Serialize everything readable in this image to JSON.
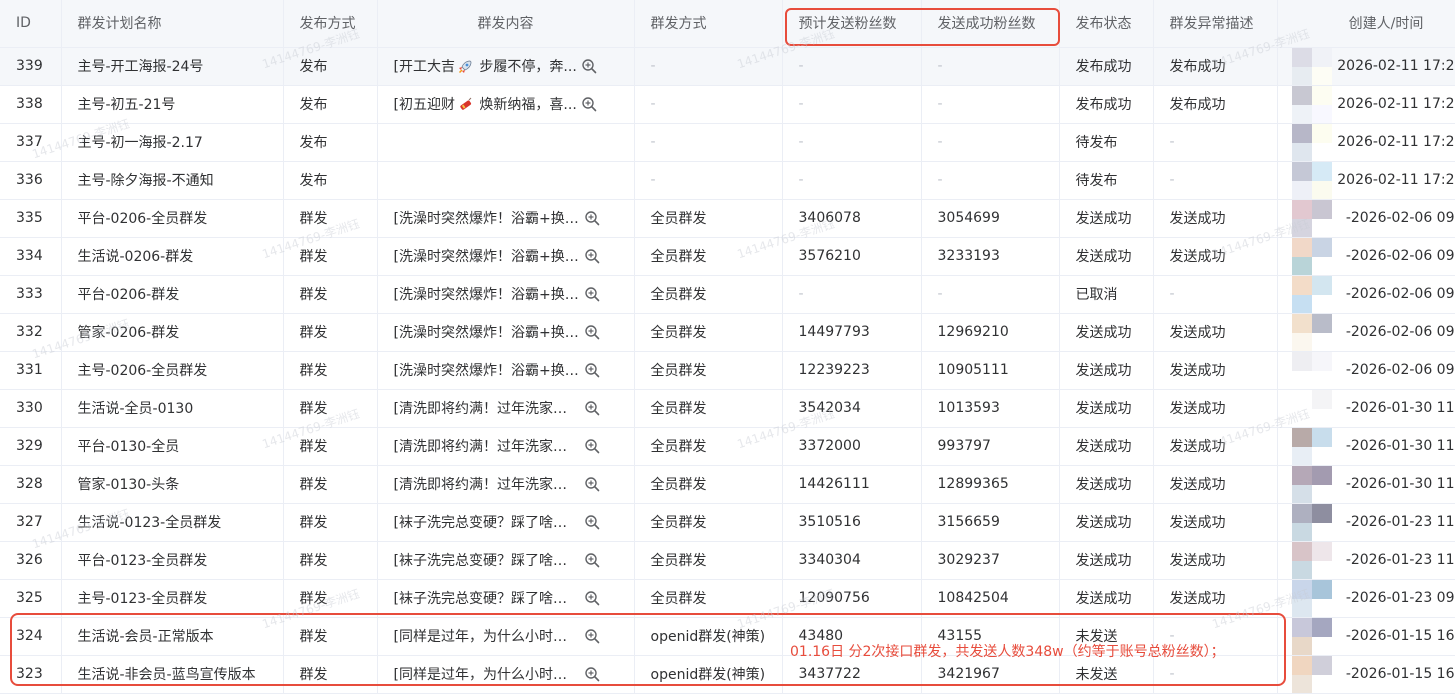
{
  "table": {
    "headers": {
      "id": "ID",
      "plan_name": "群发计划名称",
      "publish_method": "发布方式",
      "content": "群发内容",
      "mass_method": "群发方式",
      "expected_fans": "预计发送粉丝数",
      "success_fans": "发送成功粉丝数",
      "publish_status": "发布状态",
      "anomaly": "群发异常描述",
      "creator_time": "创建人/时间"
    },
    "rows": [
      {
        "id": "339",
        "name": "主号-开工海报-24号",
        "method": "发布",
        "content_pre": "[开工大吉",
        "emoji": "rocket",
        "content_post": " 步履不停，奔...",
        "mass": "-",
        "expected": "-",
        "success": "-",
        "status": "发布成功",
        "anomaly": "发布成功",
        "time": "2026-02-11 17:2"
      },
      {
        "id": "338",
        "name": "主号-初五-21号",
        "method": "发布",
        "content_pre": "[初五迎财",
        "emoji": "firecracker",
        "content_post": " 焕新纳福，喜...",
        "mass": "-",
        "expected": "-",
        "success": "-",
        "status": "发布成功",
        "anomaly": "发布成功",
        "time": "2026-02-11 17:2"
      },
      {
        "id": "337",
        "name": "主号-初一海报-2.17",
        "method": "发布",
        "content_pre": "",
        "emoji": "",
        "content_post": "",
        "mass": "-",
        "expected": "-",
        "success": "-",
        "status": "待发布",
        "anomaly": "-",
        "time": "2026-02-11 17:2"
      },
      {
        "id": "336",
        "name": "主号-除夕海报-不通知",
        "method": "发布",
        "content_pre": "",
        "emoji": "",
        "content_post": "",
        "mass": "-",
        "expected": "-",
        "success": "-",
        "status": "待发布",
        "anomaly": "-",
        "time": "2026-02-11 17:2"
      },
      {
        "id": "335",
        "name": "平台-0206-全员群发",
        "method": "群发",
        "content_pre": "[洗澡时突然爆炸！浴霸+换气...",
        "emoji": "",
        "content_post": "",
        "mass": "全员群发",
        "expected": "3406078",
        "success": "3054699",
        "status": "发送成功",
        "anomaly": "发送成功",
        "time": "-2026-02-06 09"
      },
      {
        "id": "334",
        "name": "生活说-0206-群发",
        "method": "群发",
        "content_pre": "[洗澡时突然爆炸！浴霸+换气...",
        "emoji": "",
        "content_post": "",
        "mass": "全员群发",
        "expected": "3576210",
        "success": "3233193",
        "status": "发送成功",
        "anomaly": "发送成功",
        "time": "-2026-02-06 09"
      },
      {
        "id": "333",
        "name": "平台-0206-群发",
        "method": "群发",
        "content_pre": "[洗澡时突然爆炸！浴霸+换气...",
        "emoji": "",
        "content_post": "",
        "mass": "全员群发",
        "expected": "-",
        "success": "-",
        "status": "已取消",
        "anomaly": "-",
        "time": "-2026-02-06 09"
      },
      {
        "id": "332",
        "name": "管家-0206-群发",
        "method": "群发",
        "content_pre": "[洗澡时突然爆炸！浴霸+换气...",
        "emoji": "",
        "content_post": "",
        "mass": "全员群发",
        "expected": "14497793",
        "success": "12969210",
        "status": "发送成功",
        "anomaly": "发送成功",
        "time": "-2026-02-06 09"
      },
      {
        "id": "331",
        "name": "主号-0206-全员群发",
        "method": "群发",
        "content_pre": "[洗澡时突然爆炸！浴霸+换气...",
        "emoji": "",
        "content_post": "",
        "mass": "全员群发",
        "expected": "12239223",
        "success": "10905111",
        "status": "发送成功",
        "anomaly": "发送成功",
        "time": "-2026-02-06 09"
      },
      {
        "id": "330",
        "name": "生活说-全员-0130",
        "method": "群发",
        "content_pre": "[清洗即将约满！过年洗家电早...",
        "emoji": "",
        "content_post": "",
        "mass": "全员群发",
        "expected": "3542034",
        "success": "1013593",
        "status": "发送成功",
        "anomaly": "发送成功",
        "time": "-2026-01-30 11"
      },
      {
        "id": "329",
        "name": "平台-0130-全员",
        "method": "群发",
        "content_pre": "[清洗即将约满！过年洗家电早...",
        "emoji": "",
        "content_post": "",
        "mass": "全员群发",
        "expected": "3372000",
        "success": "993797",
        "status": "发送成功",
        "anomaly": "发送成功",
        "time": "-2026-01-30 11"
      },
      {
        "id": "328",
        "name": "管家-0130-头条",
        "method": "群发",
        "content_pre": "[清洗即将约满！过年洗家电早...",
        "emoji": "",
        "content_post": "",
        "mass": "全员群发",
        "expected": "14426111",
        "success": "12899365",
        "status": "发送成功",
        "anomaly": "发送成功",
        "time": "-2026-01-30 11"
      },
      {
        "id": "327",
        "name": "生活说-0123-全员群发",
        "method": "群发",
        "content_pre": "[袜子洗完总变硬？踩了啥坑？...",
        "emoji": "",
        "content_post": "",
        "mass": "全员群发",
        "expected": "3510516",
        "success": "3156659",
        "status": "发送成功",
        "anomaly": "发送成功",
        "time": "-2026-01-23 11"
      },
      {
        "id": "326",
        "name": "平台-0123-全员群发",
        "method": "群发",
        "content_pre": "[袜子洗完总变硬？踩了啥坑？...",
        "emoji": "",
        "content_post": "",
        "mass": "全员群发",
        "expected": "3340304",
        "success": "3029237",
        "status": "发送成功",
        "anomaly": "发送成功",
        "time": "-2026-01-23 11"
      },
      {
        "id": "325",
        "name": "主号-0123-全员群发",
        "method": "群发",
        "content_pre": "[袜子洗完总变硬？踩了啥坑？...",
        "emoji": "",
        "content_post": "",
        "mass": "全员群发",
        "expected": "12090756",
        "success": "10842504",
        "status": "发送成功",
        "anomaly": "发送成功",
        "time": "-2026-01-23 09"
      },
      {
        "id": "324",
        "name": "生活说-会员-正常版本",
        "method": "群发",
        "content_pre": "[同样是过年，为什么小时候的...",
        "emoji": "",
        "content_post": "",
        "mass": "openid群发(神策)",
        "expected": "43480",
        "success": "43155",
        "status": "未发送",
        "anomaly": "-",
        "time": "-2026-01-15 16"
      },
      {
        "id": "323",
        "name": "生活说-非会员-蓝鸟宣传版本",
        "method": "群发",
        "content_pre": "[同样是过年，为什么小时候的...",
        "emoji": "",
        "content_post": "",
        "mass": "openid群发(神策)",
        "expected": "3437722",
        "success": "3421967",
        "status": "未发送",
        "anomaly": "-",
        "time": "-2026-01-15 16"
      }
    ]
  },
  "annotation": "01.16日 分2次接口群发，共发送人数348w（约等于账号总粉丝数）；",
  "watermark": "14144769-李洲钰",
  "colors": {
    "highlight": "#e74c3c",
    "header_bg": "#f5f7fa",
    "border": "#ebeef5"
  }
}
